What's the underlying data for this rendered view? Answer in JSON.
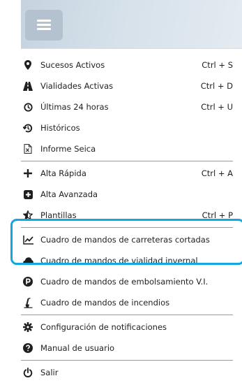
{
  "menu": {
    "sucesos": {
      "label": "Sucesos Activos",
      "shortcut": "Ctrl + S",
      "icon": "map-marker-icon"
    },
    "vialidades": {
      "label": "Vialidades Activas",
      "shortcut": "Ctrl + D",
      "icon": "road-icon"
    },
    "ultimas": {
      "label": "Últimas 24 horas",
      "shortcut": "Ctrl + U",
      "icon": "clock-icon"
    },
    "historicos": {
      "label": "Históricos",
      "icon": "history-icon"
    },
    "informe": {
      "label": "Informe Seica",
      "icon": "excel-file-icon"
    },
    "alta_rapida": {
      "label": "Alta Rápida",
      "shortcut": "Ctrl + A",
      "icon": "plus-icon"
    },
    "alta_avanzada": {
      "label": "Alta Avanzada",
      "icon": "plus-square-icon"
    },
    "plantillas": {
      "label": "Plantillas",
      "shortcut": "Ctrl + P",
      "icon": "star-icon"
    },
    "carreteras": {
      "label": "Cuadro de mandos de carreteras cortadas",
      "icon": "line-chart-icon"
    },
    "vialidad_invernal": {
      "label": "Cuadro de mandos de vialidad invernal",
      "icon": "cloud-icon"
    },
    "embolsamiento": {
      "label": "Cuadro de mandos de embolsamiento V.I.",
      "icon": "parking-icon"
    },
    "incendios": {
      "label": "Cuadro de mandos de incendios",
      "icon": "fire-extinguisher-icon"
    },
    "notificaciones": {
      "label": "Configuración de notificaciones",
      "icon": "gear-icon"
    },
    "manual": {
      "label": "Manual de usuario",
      "icon": "question-circle-icon"
    },
    "salir": {
      "label": "Salir",
      "icon": "power-icon"
    }
  },
  "colors": {
    "highlight": "#13a7df",
    "header_button": "#b4c2d0",
    "header_bg": "#d6e1ea"
  }
}
